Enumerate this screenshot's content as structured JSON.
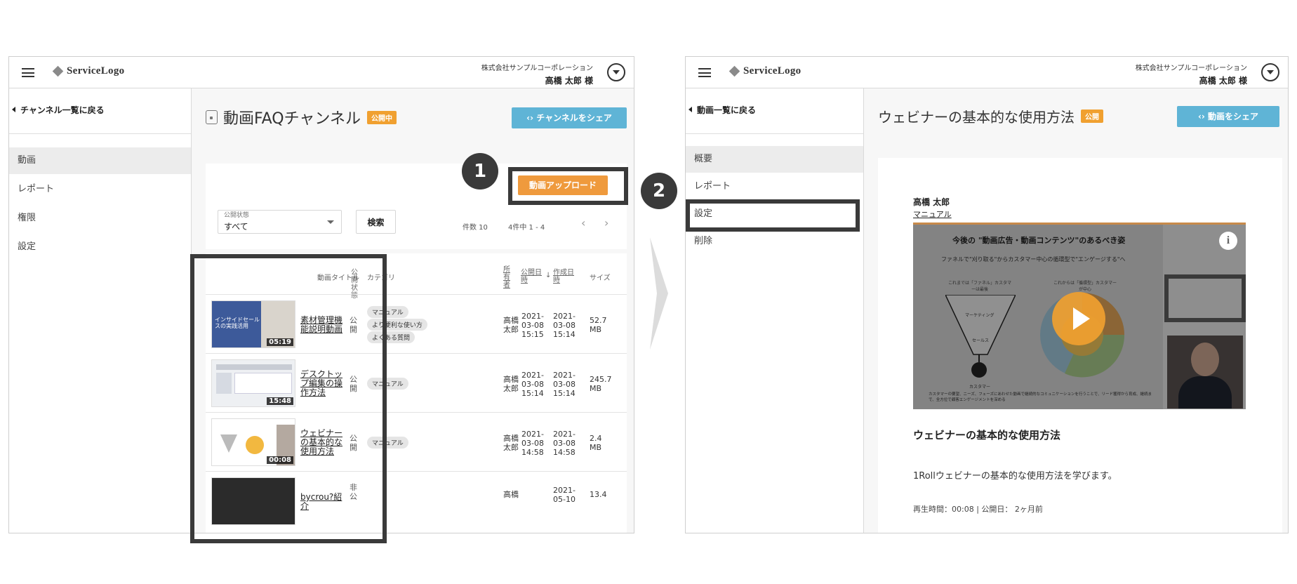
{
  "steps": [
    "1",
    "2"
  ],
  "colors": {
    "accent_orange": "#ef9a3d",
    "share_blue": "#5fb4d6",
    "badge_orange": "#f0a030",
    "highlight": "#3a3a3a"
  },
  "left": {
    "header": {
      "logo": "ServiceLogo",
      "company": "株式会社サンプルコーポレーション",
      "user": "高橋 太郎 様"
    },
    "sidebar": {
      "back": "チャンネル一覧に戻る",
      "items": [
        {
          "label": "動画",
          "active": true
        },
        {
          "label": "レポート",
          "active": false
        },
        {
          "label": "権限",
          "active": false
        },
        {
          "label": "設定",
          "active": false
        }
      ]
    },
    "page": {
      "title": "動画FAQチャンネル",
      "badge": "公開中",
      "share": "チャンネルをシェア",
      "upload": "動画アップロード",
      "filter_label": "公開状態",
      "filter_value": "すべて",
      "search": "検索",
      "count": "件数 10",
      "range": "4件中 1 - 4"
    },
    "table": {
      "headers": {
        "title": "動画タイトル",
        "status": "公開状態",
        "category": "カテゴリ",
        "owner": "所有者",
        "published": "公開日時",
        "created": "作成日時",
        "size": "サイズ"
      },
      "rows": [
        {
          "thumb_text": "インサイドセールスの実践活用",
          "duration": "05:19",
          "title": "素材管理機能説明動画",
          "status": "公開",
          "tags": [
            "マニュアル",
            "より便利な使い方",
            "よくある質問"
          ],
          "owner": "高橋太郎",
          "published": "2021-03-08 15:15",
          "created": "2021-03-08 15:14",
          "size": "52.7 MB"
        },
        {
          "thumb_text": "",
          "duration": "15:48",
          "title": "デスクトップ編集の操作方法",
          "status": "公開",
          "tags": [
            "マニュアル"
          ],
          "owner": "高橋太郎",
          "published": "2021-03-08 15:14",
          "created": "2021-03-08 15:14",
          "size": "245.7 MB"
        },
        {
          "thumb_text": "",
          "duration": "00:08",
          "title": "ウェビナーの基本的な使用方法",
          "status": "公開",
          "tags": [
            "マニュアル"
          ],
          "owner": "高橋太郎",
          "published": "2021-03-08 14:58",
          "created": "2021-03-08 14:58",
          "size": "2.4 MB"
        },
        {
          "thumb_text": "",
          "duration": "",
          "title": "bycrou?紹介",
          "status": "非公",
          "tags": [],
          "owner": "高橋",
          "published": "",
          "created": "2021-05-10",
          "size": "13.4"
        }
      ]
    }
  },
  "right": {
    "header": {
      "logo": "ServiceLogo",
      "company": "株式会社サンプルコーポレーション",
      "user": "高橋 太郎 様"
    },
    "sidebar": {
      "back": "動画一覧に戻る",
      "items": [
        {
          "label": "概要",
          "active": true
        },
        {
          "label": "レポート",
          "active": false
        },
        {
          "label": "設定",
          "active": false
        },
        {
          "label": "削除",
          "active": false
        }
      ]
    },
    "page": {
      "title": "ウェビナーの基本的な使用方法",
      "badge": "公開",
      "share": "動画をシェア",
      "author": "高橋 太郎",
      "author_tag": "マニュアル",
      "slide_heading": "今後の \"動画広告・動画コンテンツ\"のあるべき姿",
      "slide_sub": "ファネルで\"刈り取る\"からカスタマー中心の循環型で\"エンゲージする\"へ",
      "slide_left": "これまでは「ファネル」カスタマーは最後",
      "slide_right": "これからは「循環型」カスタマーが中心",
      "funnel_top": "マーケティング",
      "funnel_mid": "セールス",
      "funnel_bottom": "カスタマー",
      "slide_footer": "カスタマーの要望、ニーズ、フェーズにあわせた動画で継続的なコミュニケーションを行うことで、リード獲得から育成、継続まで、全方位で顧客エンゲージメントを深める",
      "video_heading": "ウェビナーの基本的な使用方法",
      "description": "1Rollウェビナーの基本的な使用方法を学びます。",
      "meta": "再生時間：00:08 | 公開日： 2ヶ月前"
    }
  }
}
